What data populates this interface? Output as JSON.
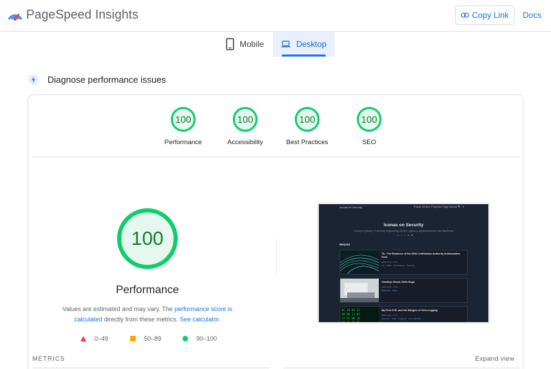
{
  "header": {
    "app_title": "PageSpeed Insights",
    "copy_link_label": "Copy Link",
    "docs_label": "Docs"
  },
  "tabs": [
    {
      "label": "Mobile",
      "selected": false
    },
    {
      "label": "Desktop",
      "selected": true
    }
  ],
  "section": {
    "title": "Diagnose performance issues"
  },
  "categories": [
    {
      "label": "Performance",
      "score": "100"
    },
    {
      "label": "Accessibility",
      "score": "100"
    },
    {
      "label": "Best Practices",
      "score": "100"
    },
    {
      "label": "SEO",
      "score": "100"
    }
  ],
  "performance": {
    "score": "100",
    "title": "Performance",
    "desc_1": "Values are estimated and may vary. The ",
    "desc_link_1": "performance score is calculated",
    "desc_2": " directly from these metrics. ",
    "desc_link_2": "See calculator.",
    "legend": [
      {
        "range": "0–49",
        "color": "#ff3333"
      },
      {
        "range": "50–89",
        "color": "#ffa400"
      },
      {
        "range": "90–100",
        "color": "#0cce6b"
      }
    ]
  },
  "metrics": {
    "label": "METRICS",
    "expand_label": "Expand view"
  },
  "screenshot": {
    "brand": "Iconas on Security",
    "menu": "Posts  Series  Projects  Tags  About  🔍  ☀",
    "hero_title": "Iconas on Security",
    "hero_subtitle": "A blog on privacy, IT security, engineering, OSINT, opinions, cryptocurrencies, and ItaloFresa",
    "hero_icons": "◔ ◕ ◖ ◗ ◘ ◙",
    "recent_label": "Recent",
    "posts": [
      {
        "title": "TIL: The Existence of the DNS Certification Authority Authorization Field",
        "meta": "2023-01-10 · 3 min",
        "tags": "TIL · DNS · Certificates · Security"
      },
      {
        "title": "Goodbye Ghost, Hello Hugo",
        "meta": "2022-12-08 · 4 min",
        "tags": "Blogging · Hugo"
      },
      {
        "title": "My First CVE, and the Dangers of Over-Logging",
        "meta": "2022-11-10 · 6 min",
        "tags": "Security · CVE · Logging · Vulnerability"
      }
    ]
  },
  "colors": {
    "accent": "#1a73e8",
    "pass": "#0cce6b",
    "pass_text": "#0c7e2f",
    "pass_fill": "#e6f7ed"
  }
}
